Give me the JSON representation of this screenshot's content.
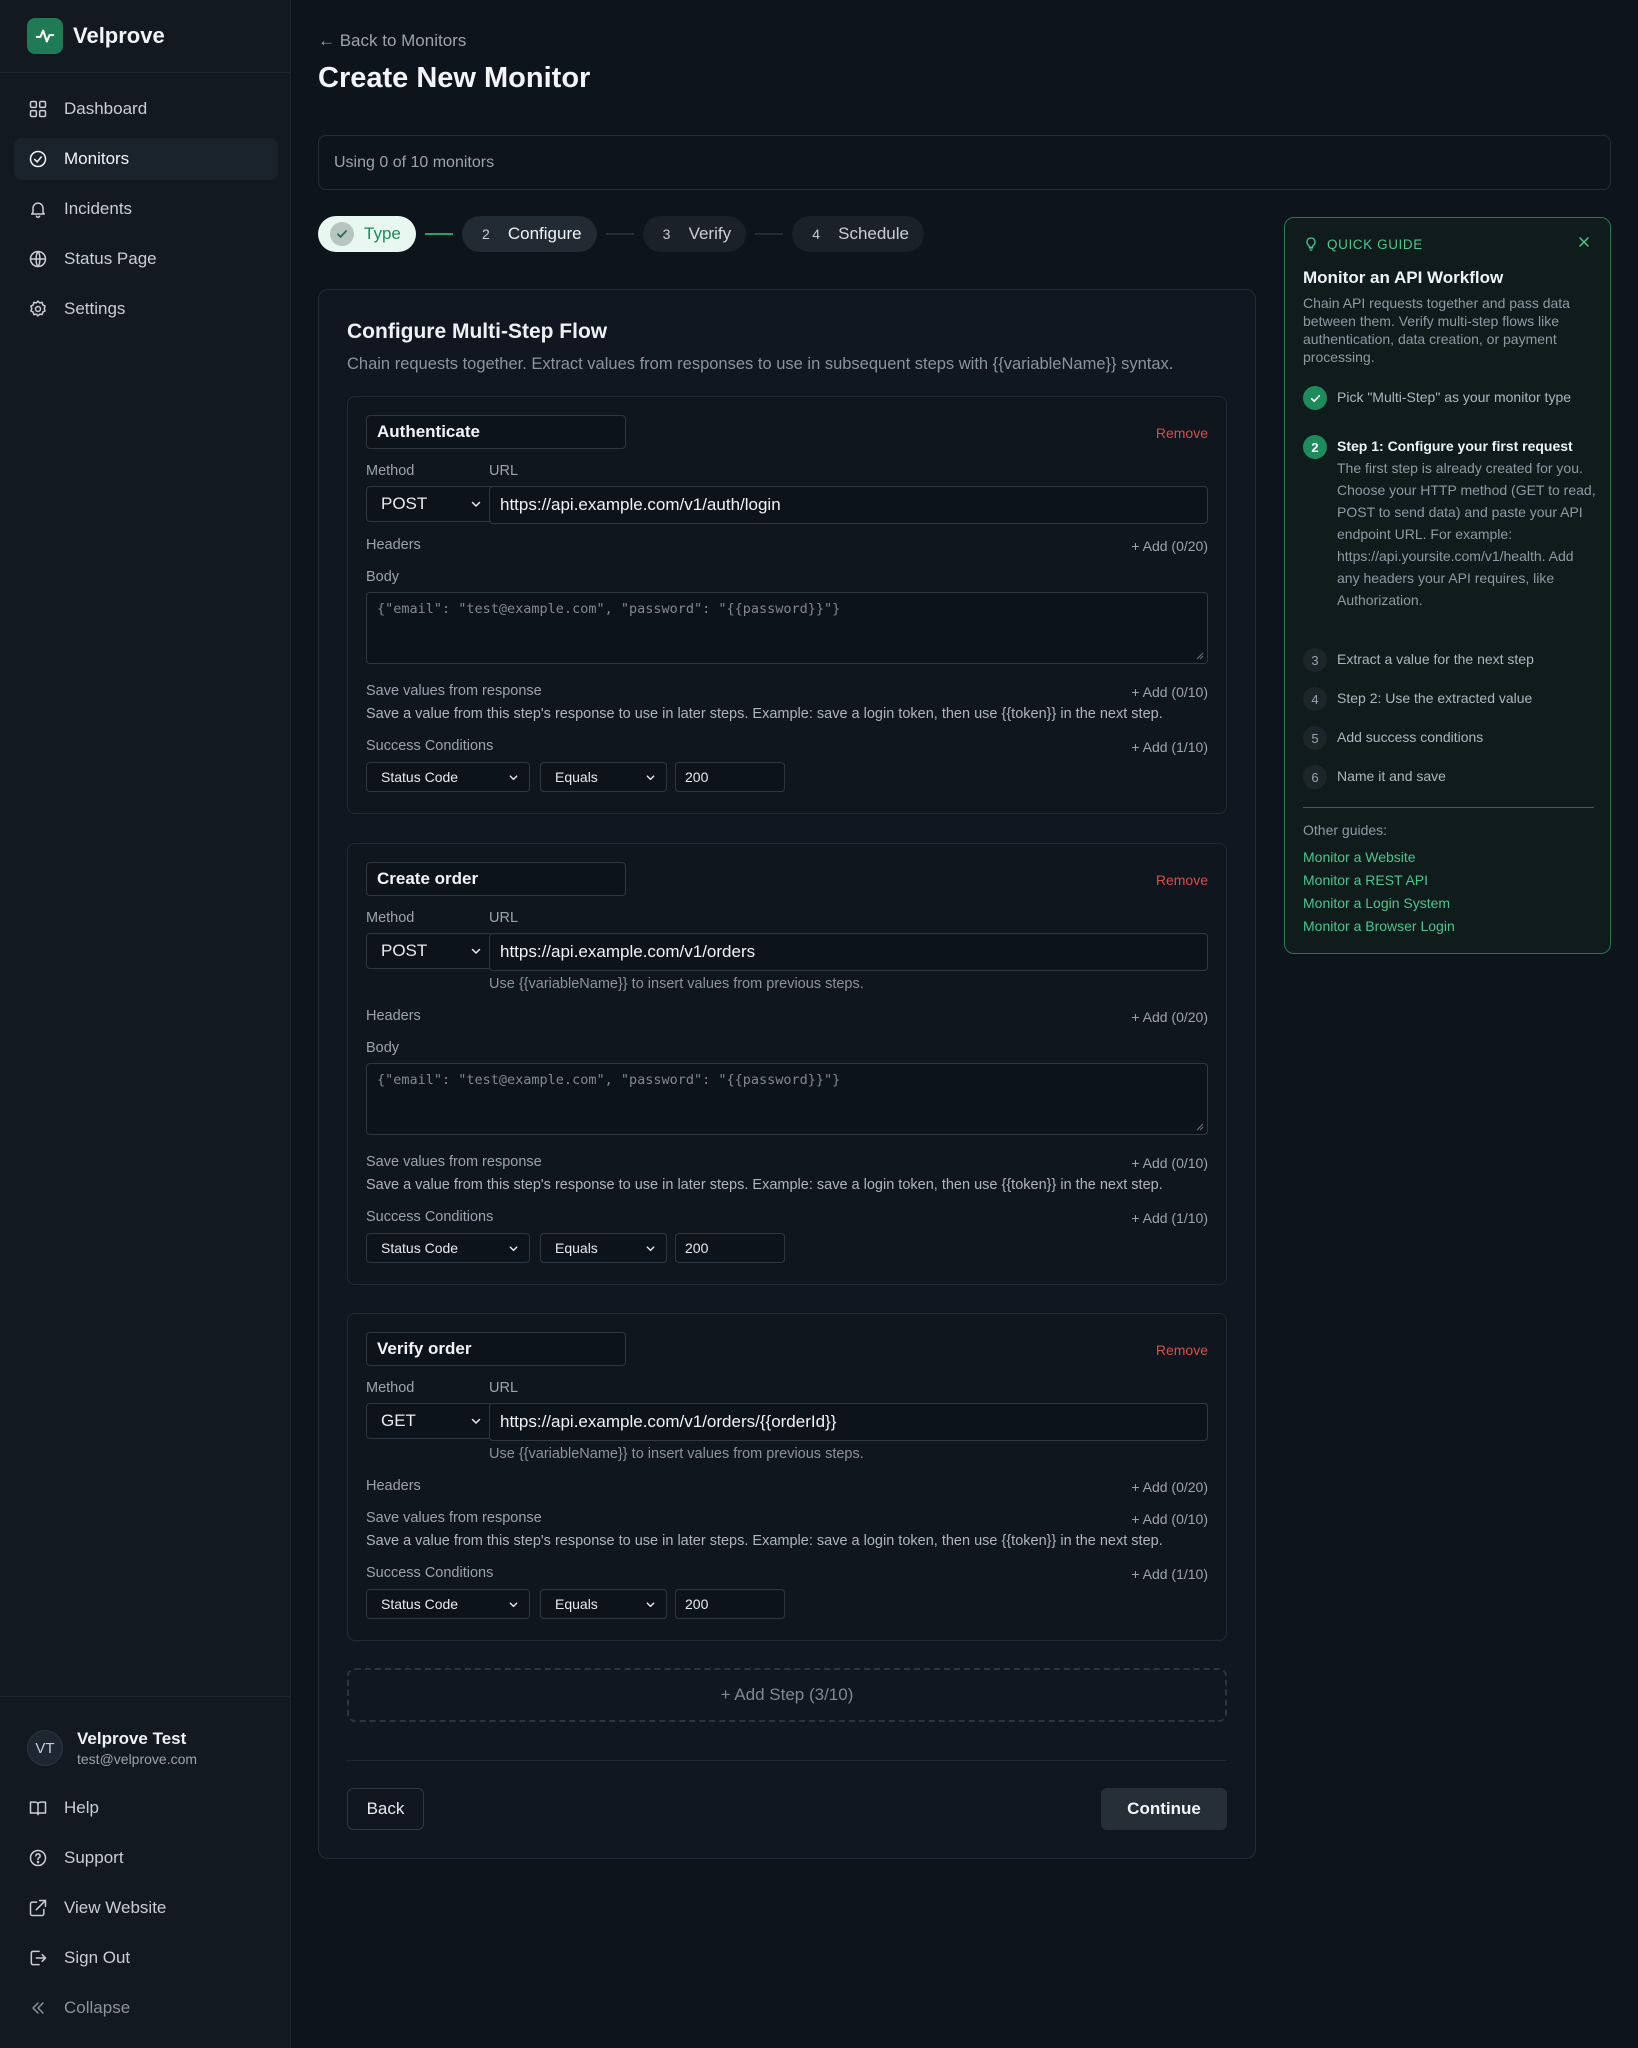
{
  "brand": {
    "name": "Velprove"
  },
  "sidebar": {
    "items": [
      {
        "label": "Dashboard",
        "icon": "dashboard-icon"
      },
      {
        "label": "Monitors",
        "icon": "monitors-icon",
        "active": true
      },
      {
        "label": "Incidents",
        "icon": "bell-icon"
      },
      {
        "label": "Status Page",
        "icon": "globe-icon"
      },
      {
        "label": "Settings",
        "icon": "gear-icon"
      }
    ],
    "user": {
      "initials": "VT",
      "name": "Velprove Test",
      "email": "test@velprove.com"
    },
    "bottom": [
      {
        "label": "Help",
        "icon": "book-icon"
      },
      {
        "label": "Support",
        "icon": "question-icon"
      },
      {
        "label": "View Website",
        "icon": "external-link-icon"
      },
      {
        "label": "Sign Out",
        "icon": "sign-out-icon"
      },
      {
        "label": "Collapse",
        "icon": "collapse-icon"
      }
    ]
  },
  "header": {
    "back": "← Back to Monitors",
    "title": "Create New Monitor",
    "usage": "Using 0 of 10 monitors"
  },
  "stepper": [
    {
      "num": "",
      "label": "Type",
      "state": "done"
    },
    {
      "num": "2",
      "label": "Configure",
      "state": "current"
    },
    {
      "num": "3",
      "label": "Verify",
      "state": "upcoming"
    },
    {
      "num": "4",
      "label": "Schedule",
      "state": "upcoming"
    }
  ],
  "form": {
    "title": "Configure Multi-Step Flow",
    "subtitle": "Chain requests together. Extract values from responses to use in subsequent steps with {{variableName}} syntax.",
    "labels": {
      "remove": "Remove",
      "method": "Method",
      "url": "URL",
      "headers": "Headers",
      "body": "Body",
      "save_values": "Save values from response",
      "save_desc": "Save a value from this step's response to use in later steps. Example: save a login token, then use {{token}} in the next step.",
      "success": "Success Conditions",
      "url_hint": "Use {{variableName}} to insert values from previous steps."
    },
    "steps": [
      {
        "name": "Authenticate",
        "method": "POST",
        "url": "https://api.example.com/v1/auth/login",
        "headers_add": "+ Add (0/20)",
        "body_placeholder": "{\"email\": \"test@example.com\", \"password\": \"{{password}}\"}",
        "save_add": "+ Add (0/10)",
        "success_add": "+ Add (1/10)",
        "condition": {
          "field": "Status Code",
          "op": "Equals",
          "value": "200"
        }
      },
      {
        "name": "Create order",
        "method": "POST",
        "url": "https://api.example.com/v1/orders",
        "headers_add": "+ Add (0/20)",
        "body_placeholder": "{\"email\": \"test@example.com\", \"password\": \"{{password}}\"}",
        "save_add": "+ Add (0/10)",
        "success_add": "+ Add (1/10)",
        "condition": {
          "field": "Status Code",
          "op": "Equals",
          "value": "200"
        }
      },
      {
        "name": "Verify order",
        "method": "GET",
        "url": "https://api.example.com/v1/orders/{{orderId}}",
        "headers_add": "+ Add (0/20)",
        "save_add": "+ Add (0/10)",
        "success_add": "+ Add (1/10)",
        "condition": {
          "field": "Status Code",
          "op": "Equals",
          "value": "200"
        }
      }
    ],
    "add_step": "+ Add Step (3/10)",
    "back_button": "Back",
    "continue_button": "Continue"
  },
  "guide": {
    "heading": "QUICK GUIDE",
    "title": "Monitor an API Workflow",
    "description": "Chain API requests together and pass data between them. Verify multi-step flows like authentication, data creation, or payment processing.",
    "items": [
      {
        "num": "",
        "text": "Pick \"Multi-Step\" as your monitor type",
        "state": "done"
      },
      {
        "num": "2",
        "text": "Step 1: Configure your first request",
        "state": "current",
        "detail": "The first step is already created for you. Choose your HTTP method (GET to read, POST to send data) and paste your API endpoint URL. For example: https://api.yoursite.com/v1/health. Add any headers your API requires, like Authorization."
      },
      {
        "num": "3",
        "text": "Extract a value for the next step",
        "state": "upcoming"
      },
      {
        "num": "4",
        "text": "Step 2: Use the extracted value",
        "state": "upcoming"
      },
      {
        "num": "5",
        "text": "Add success conditions",
        "state": "upcoming"
      },
      {
        "num": "6",
        "text": "Name it and save",
        "state": "upcoming"
      }
    ],
    "other_label": "Other guides:",
    "links": [
      "Monitor a Website",
      "Monitor a REST API",
      "Monitor a Login System",
      "Monitor a Browser Login"
    ]
  },
  "colors": {
    "accent": "#1f8a5c",
    "accent_text": "#4cc58f",
    "danger": "#d94c4c",
    "background": "#0e141c"
  }
}
